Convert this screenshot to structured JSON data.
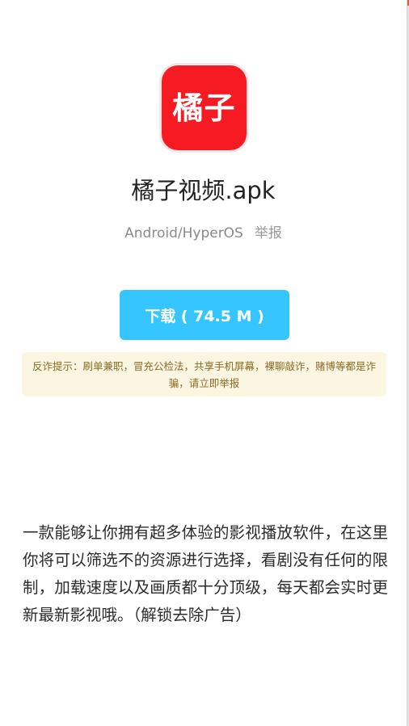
{
  "app": {
    "icon_text": "橘子",
    "name": "橘子视频.apk",
    "platform": "Android/HyperOS",
    "report_label": "举报"
  },
  "download": {
    "label": "下载 ( 74.5 M )"
  },
  "warning": {
    "text": "反诈提示：刷单兼职，冒充公检法，共享手机屏幕，裸聊敲诈，赌博等都是诈骗，请立即举报"
  },
  "description": {
    "text": "一款能够让你拥有超多体验的影视播放软件，在这里你将可以筛选不的资源进行选择，看剧没有任何的限制，加载速度以及画质都十分顶级，每天都会实时更新最新影视哦。（解锁去除广告）"
  },
  "colors": {
    "icon_bg": "#f61b23",
    "button_bg": "#36c6ff",
    "warning_bg": "#fbf6e2",
    "warning_text": "#8c6a24"
  }
}
